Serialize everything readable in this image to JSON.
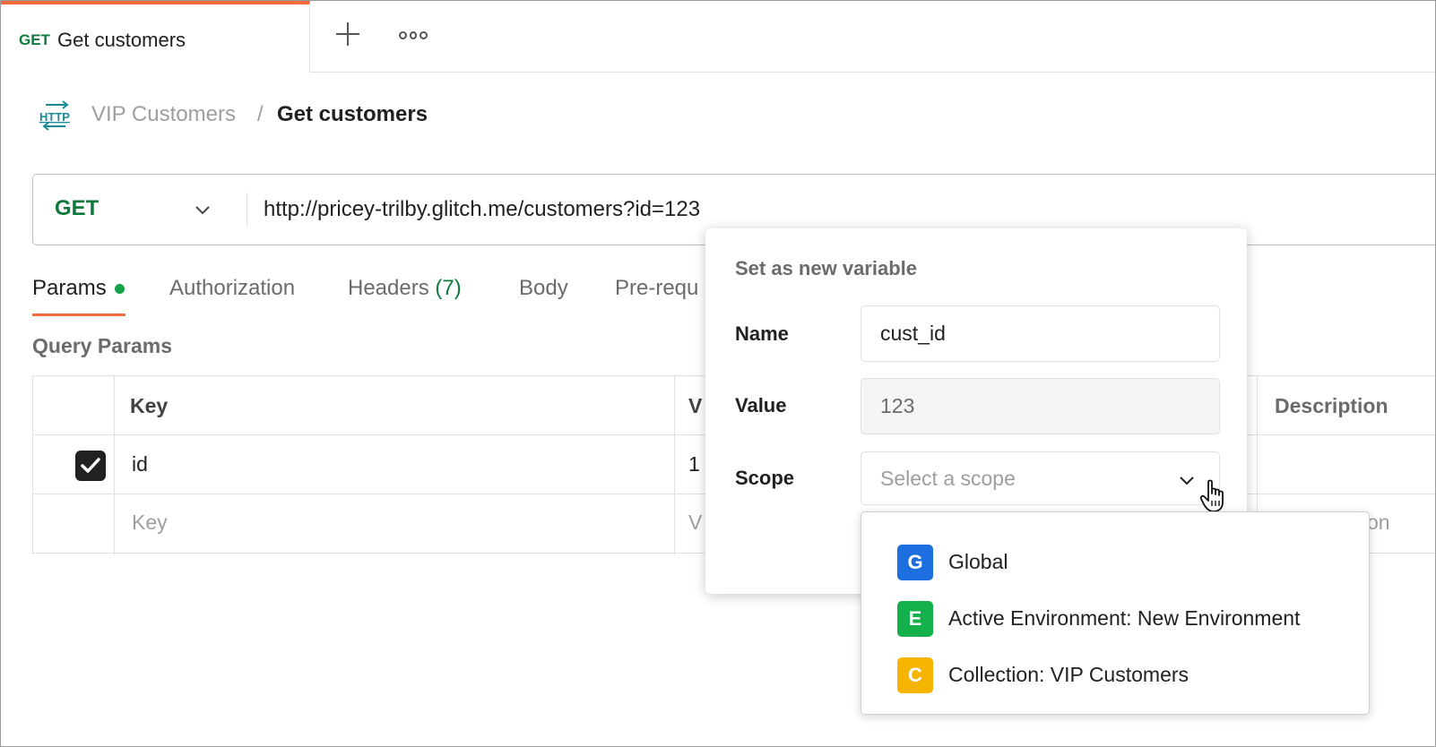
{
  "tab": {
    "method": "GET",
    "title": "Get customers"
  },
  "breadcrumb": {
    "parent": "VIP Customers",
    "separator": "/",
    "current": "Get customers"
  },
  "request": {
    "method": "GET",
    "url": "http://pricey-trilby.glitch.me/customers?id=123"
  },
  "request_tabs": {
    "params": "Params",
    "authorization": "Authorization",
    "headers": "Headers",
    "headers_count": "(7)",
    "body": "Body",
    "pre_request": "Pre-requ"
  },
  "query_params": {
    "title": "Query Params",
    "columns": {
      "key": "Key",
      "value_partial": "V",
      "description": "Description"
    },
    "rows": [
      {
        "key": "id",
        "value_partial": "1",
        "checked": true
      }
    ],
    "placeholder": {
      "key": "Key",
      "value_partial": "V",
      "description_partial": "on"
    }
  },
  "set_variable": {
    "title": "Set as new variable",
    "name_label": "Name",
    "name_value": "cust_id",
    "value_label": "Value",
    "value_value": "123",
    "scope_label": "Scope",
    "scope_placeholder": "Select a scope"
  },
  "scope_options": [
    {
      "badge": "G",
      "label": "Global",
      "color": "#1d6fe0"
    },
    {
      "badge": "E",
      "label": "Active Environment: New Environment",
      "color": "#14b04b"
    },
    {
      "badge": "C",
      "label": "Collection: VIP Customers",
      "color": "#f5b400"
    }
  ],
  "colors": {
    "accent": "#f26b3a",
    "method_get": "#0f7a3c",
    "status_dot": "#14a34a"
  }
}
